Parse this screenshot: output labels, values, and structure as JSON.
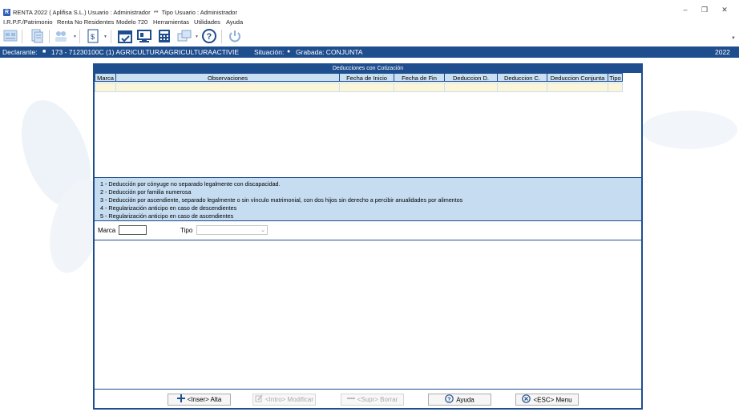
{
  "window": {
    "title": "RENTA 2022 ( Aplifisa S.L.) Usuario : Administrador  **  Tipo Usuario : Administrador",
    "app_icon_letter": "R"
  },
  "menu": {
    "items": [
      "I.R.P.F./Patrimonio",
      "Renta No Residentes",
      "Modelo 720",
      "Herramientas",
      "Utilidades",
      "Ayuda"
    ]
  },
  "toolbar": {
    "icons": [
      "irpf-icon",
      "document-icon",
      "people-icon",
      "report-icon",
      "calendar-icon",
      "monitor-icon",
      "calculator-icon",
      "windows-icon",
      "help-icon",
      "power-icon"
    ]
  },
  "status": {
    "declarante_label": "Declarante:",
    "declarante_value": "173 - 71230100C  (1) AGRICULTURAAGRICULTURAACTIVIE",
    "situacion_label": "Situación:",
    "situacion_value": "Grabada: CONJUNTA",
    "year": "2022"
  },
  "dialog": {
    "title": "Deducciones con Cotización",
    "columns": [
      "Marca",
      "Observaciones",
      "Fecha de Inicio",
      "Fecha de Fin",
      "Deduccion D.",
      "Deduccion C.",
      "Deduccion Conjunta",
      "Tipo"
    ],
    "legend": [
      "1 - Deducción por cónyuge no separado legalmente con discapacidad.",
      "2 - Deducción por familia numerosa",
      "3 - Deducción por ascendiente, separado legalmente o sin vínculo matrimonial, con dos hijos sin derecho a percibir anualidades por alimentos",
      "4 - Regularización anticipo en caso de descendientes",
      "5 - Regularización anticipo en caso de ascendientes"
    ],
    "form": {
      "marca_label": "Marca",
      "marca_value": "",
      "tipo_label": "Tipo",
      "tipo_value": ""
    },
    "buttons": {
      "alta": "<Inser> Alta",
      "modificar": "<Intro> Modificar",
      "borrar": "<Supr> Borrar",
      "ayuda": "Ayuda",
      "menu": "<ESC> Menu"
    }
  }
}
